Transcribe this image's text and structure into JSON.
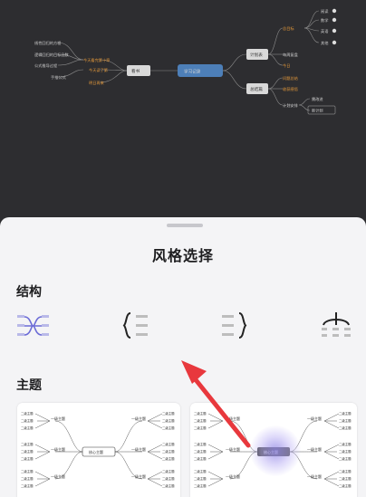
{
  "mindmap": {
    "center": "学习记录",
    "left_mid": "看书",
    "left_branches": [
      "今天看完第十章",
      "今天读了第",
      "明日再来"
    ],
    "left_leaves": [
      "线性回归的方程",
      "逻辑回归的目标函数",
      "公式推导过程",
      "手推公式"
    ],
    "right_top": "计划表",
    "right_top_branches": [
      "总目标",
      "每周复盘",
      "今日"
    ],
    "right_top_leaves": [
      "阅读",
      "数学",
      "英语",
      "其他"
    ],
    "right_bottom": "总结篇",
    "right_bottom_branches": [
      "问题总结",
      "收获感悟",
      "计划安排"
    ],
    "right_bottom_leaves": [
      "需改进",
      "新计划"
    ]
  },
  "sheet": {
    "title": "风格选择",
    "structure_label": "结构",
    "theme_label": "主题"
  },
  "themes": {
    "center_topic": "核心主题",
    "first_level": "一级主题",
    "second_level": "二级主题"
  },
  "colors": {
    "center_node": "#4d7fb8",
    "accent": "#7b7bd8",
    "arrow": "#e8383d"
  }
}
